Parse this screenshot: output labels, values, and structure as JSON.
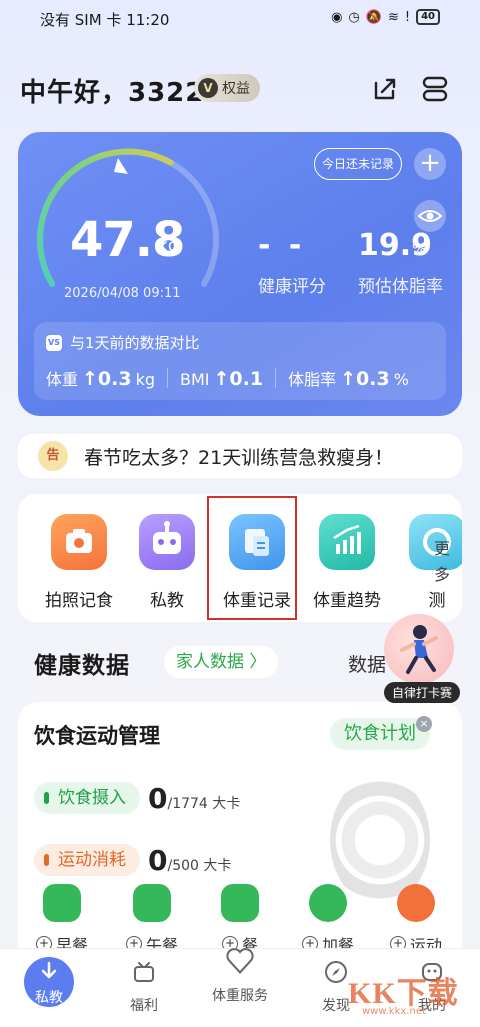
{
  "status_bar": {
    "left": "没有 SIM 卡",
    "time": "11:20",
    "battery": "40"
  },
  "header": {
    "greeting": "中午好，3322",
    "vip_badge": "V",
    "vip_label": "权益"
  },
  "weight_card": {
    "weight": "47.8",
    "weight_unit": "kg",
    "gauge_progress": 0.62,
    "datetime": "2026/04/08 09:11",
    "today_button": "今日还未记录",
    "plus": "+",
    "health_score": "- -",
    "health_score_label": "健康评分",
    "body_fat": "19.9",
    "body_fat_unit": "%",
    "body_fat_label": "预估体脂率",
    "compare": {
      "vs": "VS",
      "title": "与1天前的数据对比",
      "weight_label": "体重",
      "weight_value": "↑0.3",
      "weight_unit": "kg",
      "bmi_label": "BMI",
      "bmi_value": "↑0.1",
      "fat_label": "体脂率",
      "fat_value": "↑0.3",
      "fat_unit": "%"
    }
  },
  "banner": {
    "badge": "告",
    "text": "春节吃太多？21天训练营急救瘦身！"
  },
  "tools": [
    {
      "label": "拍照记食",
      "color": "#f7894a"
    },
    {
      "label": "私教",
      "color": "#9b7cf3"
    },
    {
      "label": "体重记录",
      "color": "#4ea3f2"
    },
    {
      "label": "体重趋势",
      "color": "#32c6b6"
    },
    {
      "label": "测",
      "color": "#5bc8e8"
    }
  ],
  "tools_more": "更多",
  "health": {
    "title": "健康数据",
    "family": "家人数据 〉",
    "more_tab": "数据"
  },
  "checkin": {
    "label": "自律打卡赛"
  },
  "diet": {
    "title": "饮食运动管理",
    "plan": "饮食计划",
    "close": "×",
    "intake_label": "饮食摄入",
    "intake_value": "0",
    "intake_target": "/1774 大卡",
    "burn_label": "运动消耗",
    "burn_value": "0",
    "burn_target": "/500 大卡",
    "meals": [
      {
        "label": "早餐",
        "color": "#35b85a"
      },
      {
        "label": "午餐",
        "color": "#35b85a"
      },
      {
        "label": "餐",
        "color": "#35b85a"
      },
      {
        "label": "加餐",
        "color": "#35b85a"
      },
      {
        "label": "运动",
        "color": "#f2703a"
      }
    ]
  },
  "nav": [
    {
      "label": "私教"
    },
    {
      "label": "福利"
    },
    {
      "label": "体重服务"
    },
    {
      "label": "发现"
    },
    {
      "label": "我的"
    }
  ],
  "watermark": {
    "text": "KK下载",
    "url": "www.kkx.net"
  }
}
